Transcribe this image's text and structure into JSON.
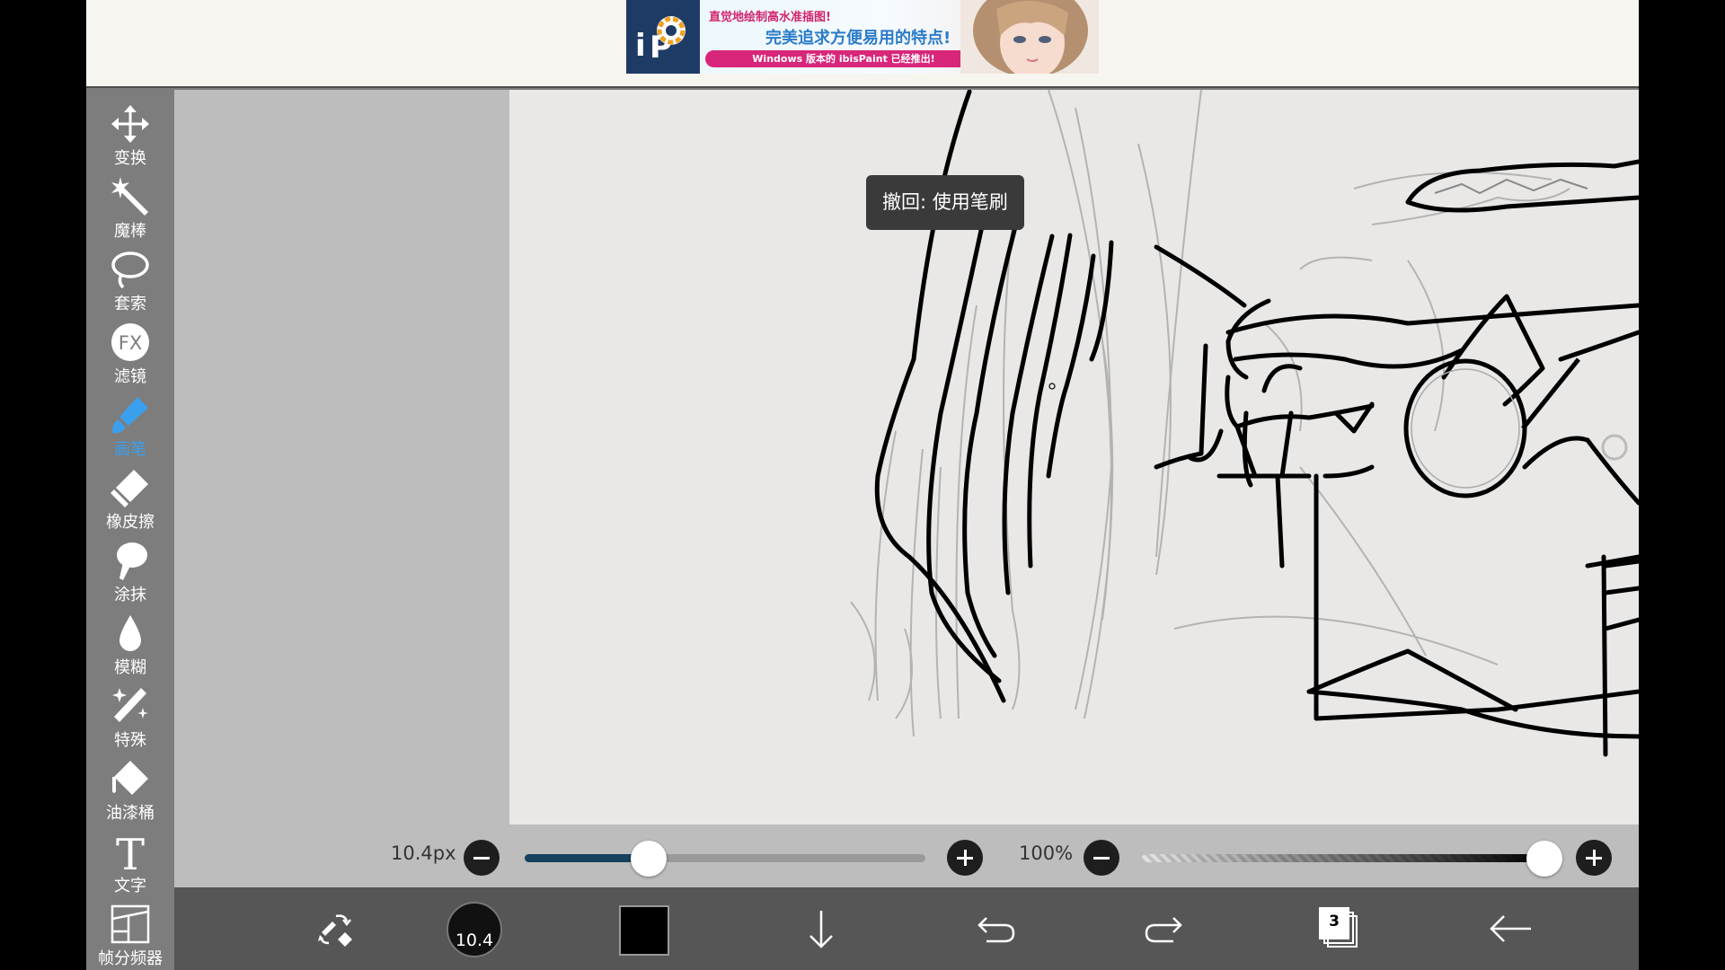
{
  "ad": {
    "line1": "直觉地绘制高水准插图!",
    "line2": "完美追求方便易用的特点!",
    "line3": "Windows 版本的 ibisPaint 已经推出!"
  },
  "tools": [
    {
      "label": "变换",
      "icon": "move-arrows-icon"
    },
    {
      "label": "魔棒",
      "icon": "magic-wand-icon"
    },
    {
      "label": "套索",
      "icon": "lasso-icon"
    },
    {
      "label": "滤镜",
      "icon": "fx-filter-icon"
    },
    {
      "label": "画笔",
      "icon": "brush-icon",
      "active": true
    },
    {
      "label": "橡皮擦",
      "icon": "eraser-icon"
    },
    {
      "label": "涂抹",
      "icon": "smudge-icon"
    },
    {
      "label": "模糊",
      "icon": "blur-drop-icon"
    },
    {
      "label": "特殊",
      "icon": "special-wand-icon"
    },
    {
      "label": "油漆桶",
      "icon": "paint-bucket-icon"
    },
    {
      "label": "文字",
      "icon": "text-icon"
    },
    {
      "label": "帧分频器",
      "icon": "frame-divider-icon"
    }
  ],
  "toast": {
    "text": "撤回: 使用笔刷"
  },
  "sliders": {
    "brush_size_label": "10.4px",
    "brush_size_fraction": 0.31,
    "opacity_label": "100%",
    "opacity_fraction": 1.0
  },
  "bottom": {
    "brush_size_value": "10.4",
    "color": "#000000",
    "layer_count": "3"
  },
  "colors": {
    "accent": "#3aa0ee",
    "toolbar": "#7d7d7d",
    "bottom_bar": "#565656"
  }
}
